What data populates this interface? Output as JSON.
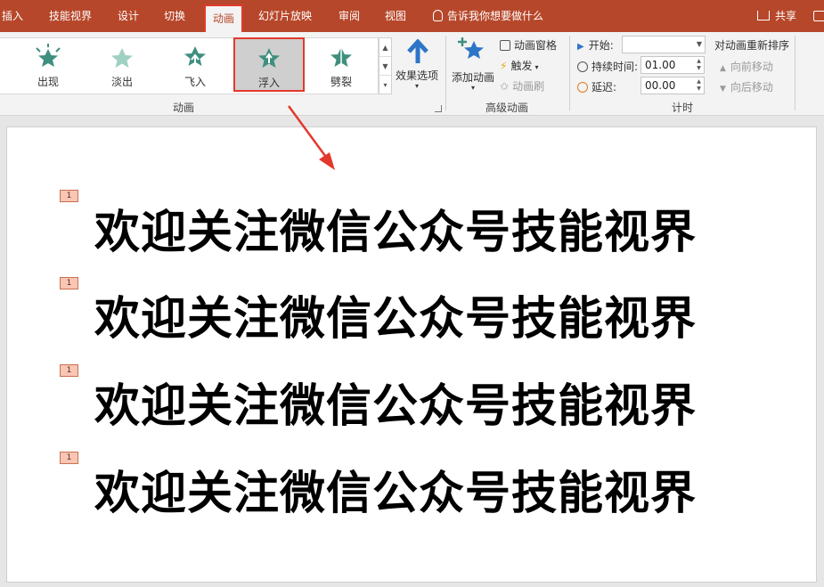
{
  "tabs": [
    {
      "label": "插入",
      "active": false
    },
    {
      "label": "技能视界",
      "active": false
    },
    {
      "label": "设计",
      "active": false
    },
    {
      "label": "切换",
      "active": false
    },
    {
      "label": "动画",
      "active": true
    },
    {
      "label": "幻灯片放映",
      "active": false
    },
    {
      "label": "审阅",
      "active": false
    },
    {
      "label": "视图",
      "active": false
    }
  ],
  "tell_me": "告诉我你想要做什么",
  "share": "共享",
  "animations": {
    "items": [
      {
        "label": "出现"
      },
      {
        "label": "淡出"
      },
      {
        "label": "飞入"
      },
      {
        "label": "浮入",
        "selected": true
      },
      {
        "label": "劈裂"
      }
    ],
    "effect_options": "效果选项",
    "group_label": "动画"
  },
  "advanced": {
    "add_animation": "添加动画",
    "pane": "动画窗格",
    "trigger": "触发",
    "painter": "动画刷",
    "group_label": "高级动画"
  },
  "timing": {
    "start_label": "开始:",
    "start_value": "",
    "duration_label": "持续时间:",
    "duration_value": "01.00",
    "delay_label": "延迟:",
    "delay_value": "00.00",
    "reorder_title": "对动画重新排序",
    "move_earlier": "向前移动",
    "move_later": "向后移动",
    "group_label": "计时"
  },
  "slide": {
    "lines": [
      {
        "tag": "1",
        "text": "欢迎关注微信公众号技能视界"
      },
      {
        "tag": "1",
        "text": "欢迎关注微信公众号技能视界"
      },
      {
        "tag": "1",
        "text": "欢迎关注微信公众号技能视界"
      },
      {
        "tag": "1",
        "text": "欢迎关注微信公众号技能视界"
      }
    ]
  },
  "colors": {
    "accent": "#b7472a",
    "highlight": "#e2392c",
    "star": "#3f8f7f"
  }
}
